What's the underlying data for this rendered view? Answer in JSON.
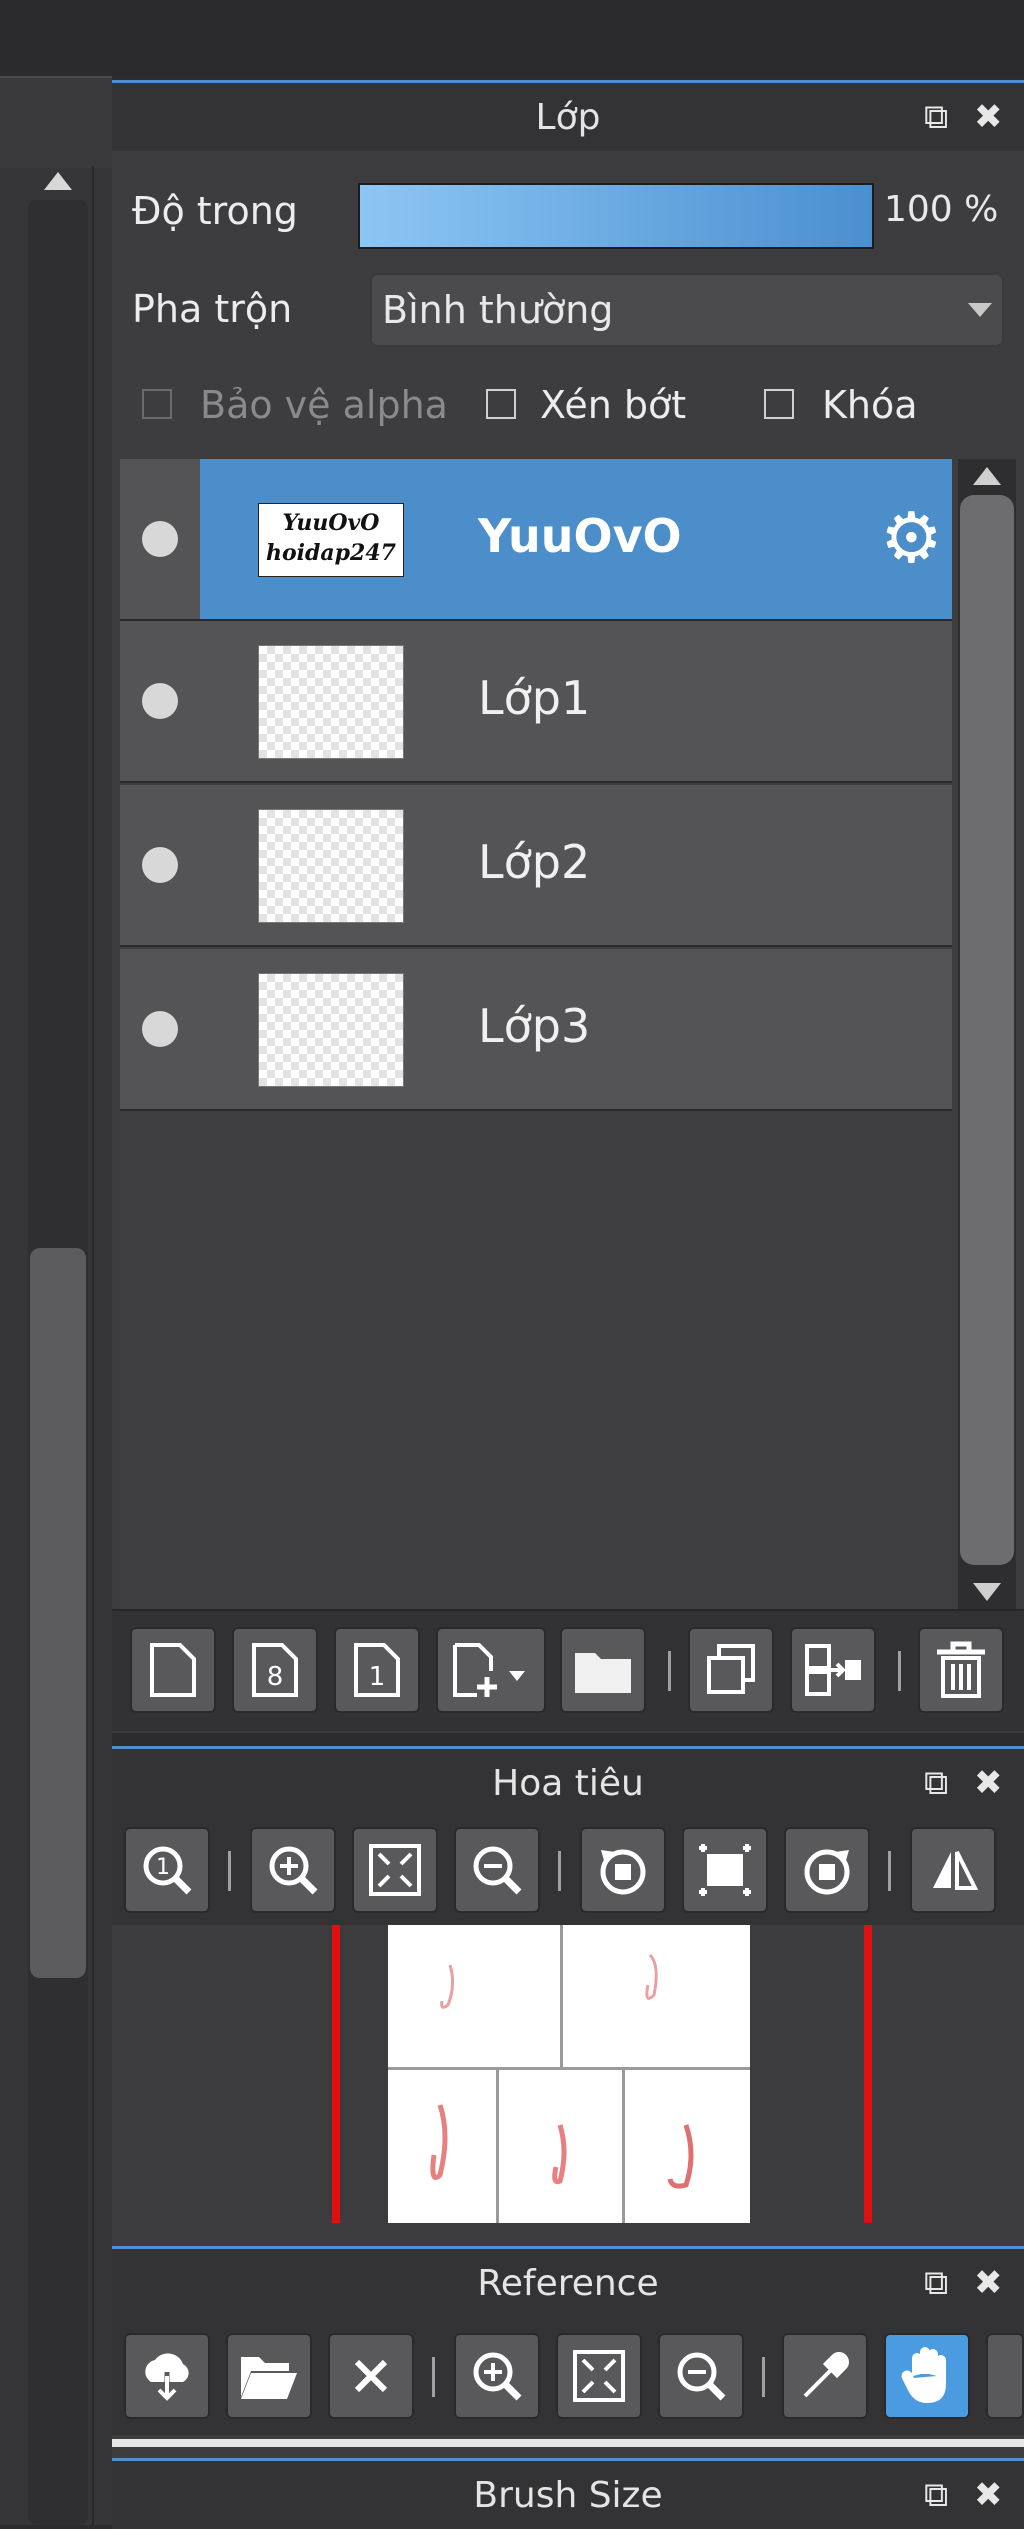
{
  "layer_panel": {
    "title": "Lớp",
    "opacity_label": "Độ trong",
    "opacity_value": "100 %",
    "opacity_fraction": 1.0,
    "blend_label": "Pha trộn",
    "blend_value": "Bình thường",
    "checkboxes": [
      {
        "label": "Bảo vệ alpha",
        "checked": false,
        "disabled": true
      },
      {
        "label": "Xén bớt",
        "checked": false,
        "disabled": false
      },
      {
        "label": "Khóa",
        "checked": false,
        "disabled": false
      }
    ],
    "layers": [
      {
        "name": "YuuOvO",
        "thumb_text_1": "YuuOvO",
        "thumb_text_2": "hoidap247",
        "selected": true
      },
      {
        "name": "Lớp1",
        "selected": false
      },
      {
        "name": "Lớp2",
        "selected": false
      },
      {
        "name": "Lớp3",
        "selected": false
      }
    ]
  },
  "navigator": {
    "title": "Hoa tiêu"
  },
  "reference": {
    "title": "Reference"
  },
  "brush_size": {
    "title": "Brush Size"
  },
  "icons": {
    "popout": "⧉",
    "close": "✖",
    "gear": "⚙"
  },
  "colors": {
    "accent": "#4b8ec9",
    "selected_tool": "#4b9be0",
    "nav_frame": "#e01010"
  }
}
